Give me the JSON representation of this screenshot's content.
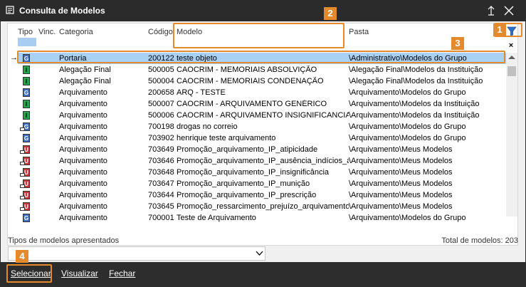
{
  "window": {
    "title": "Consulta de Modelos"
  },
  "columns": {
    "tipo": "Tipo",
    "vinc": "Vinc.",
    "categoria": "Categoria",
    "codigo": "Código",
    "modelo": "Modelo",
    "pasta": "Pasta"
  },
  "clear_filter_label": "×",
  "rows": [
    {
      "tipo": "G",
      "linked": false,
      "categoria": "Portaria",
      "codigo": "200122",
      "modelo": "teste objeto",
      "pasta": "\\Administrativo\\Modelos do Grupo",
      "selected": true
    },
    {
      "tipo": "I",
      "linked": false,
      "categoria": "Alegação Final",
      "codigo": "500005",
      "modelo": "CAOCRIM - MEMORIAIS ABSOLVIÇÃO",
      "pasta": "\\Alegação Final\\Modelos da Instituição"
    },
    {
      "tipo": "I",
      "linked": false,
      "categoria": "Alegação Final",
      "codigo": "500004",
      "modelo": "CAOCRIM - MEMORIAIS CONDENAÇÃO",
      "pasta": "\\Alegação Final\\Modelos da Instituição"
    },
    {
      "tipo": "G",
      "linked": false,
      "categoria": "Arquivamento",
      "codigo": "200658",
      "modelo": "ARQ - TESTE",
      "pasta": "\\Arquivamento\\Modelos do Grupo"
    },
    {
      "tipo": "I",
      "linked": false,
      "categoria": "Arquivamento",
      "codigo": "500007",
      "modelo": "CAOCRIM - ARQUIVAMENTO GENÉRICO",
      "pasta": "\\Arquivamento\\Modelos da Instituição"
    },
    {
      "tipo": "I",
      "linked": false,
      "categoria": "Arquivamento",
      "codigo": "500006",
      "modelo": "CAOCRIM - ARQUIVAMENTO INSIGNIFICANCIA",
      "pasta": "\\Arquivamento\\Modelos da Instituição"
    },
    {
      "tipo": "G",
      "linked": true,
      "categoria": "Arquivamento",
      "codigo": "700198",
      "modelo": "drogas no correio",
      "pasta": "\\Arquivamento\\Modelos do Grupo"
    },
    {
      "tipo": "G",
      "linked": false,
      "categoria": "Arquivamento",
      "codigo": "703902",
      "modelo": "henrique teste arquivamento",
      "pasta": "\\Arquivamento\\Modelos do Grupo"
    },
    {
      "tipo": "U",
      "linked": true,
      "categoria": "Arquivamento",
      "codigo": "703649",
      "modelo": "Promoção_arquivamento_IP_atipicidade",
      "pasta": "\\Arquivamento\\Meus Modelos"
    },
    {
      "tipo": "U",
      "linked": true,
      "categoria": "Arquivamento",
      "codigo": "703646",
      "modelo": "Promoção_arquivamento_IP_ausência_indícios_au",
      "pasta": "\\Arquivamento\\Meus Modelos"
    },
    {
      "tipo": "U",
      "linked": true,
      "categoria": "Arquivamento",
      "codigo": "703648",
      "modelo": "Promoção_arquivamento_IP_insignificância",
      "pasta": "\\Arquivamento\\Meus Modelos"
    },
    {
      "tipo": "U",
      "linked": true,
      "categoria": "Arquivamento",
      "codigo": "703647",
      "modelo": "Promoção_arquivamento_IP_munição",
      "pasta": "\\Arquivamento\\Meus Modelos"
    },
    {
      "tipo": "U",
      "linked": true,
      "categoria": "Arquivamento",
      "codigo": "703644",
      "modelo": "Promoção_arquivamento_IP_prescrição",
      "pasta": "\\Arquivamento\\Meus Modelos"
    },
    {
      "tipo": "U",
      "linked": true,
      "categoria": "Arquivamento",
      "codigo": "703645",
      "modelo": "Promoção_ressarcimento_prejuízo_arquivamento_",
      "pasta": "\\Arquivamento\\Meus Modelos"
    },
    {
      "tipo": "G",
      "linked": false,
      "categoria": "Arquivamento",
      "codigo": "700001",
      "modelo": "Teste de Arquivamento",
      "pasta": "\\Arquivamento\\Modelos do Grupo"
    }
  ],
  "current_row_marker": "→",
  "tipos_label": "Tipos de modelos apresentados",
  "total_label": "Total de modelos: 203",
  "tipos_value": "",
  "footer": {
    "selecionar": "Selecionar",
    "visualizar": "Visualizar",
    "fechar": "Fechar"
  },
  "callouts": [
    "1",
    "2",
    "3",
    "4"
  ],
  "colors": {
    "accent": "#e58a2c",
    "selection": "#a9d0f5",
    "titlebar": "#2b2b2b"
  }
}
